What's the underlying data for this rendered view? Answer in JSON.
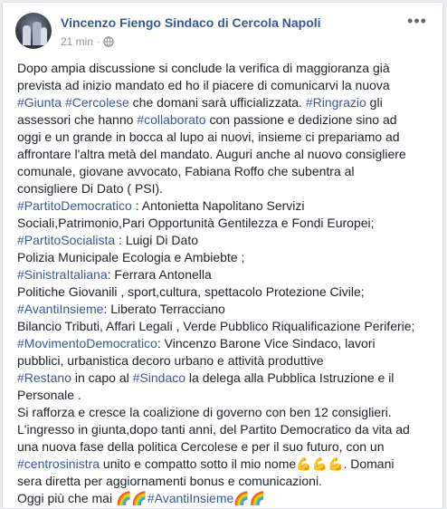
{
  "post": {
    "author": "Vincenzo Fiengo Sindaco di Cercola Napoli",
    "time": "21 min",
    "separator": "·",
    "privacy_icon": "globe-icon",
    "more_icon": "more-options-icon",
    "more_label": "•••",
    "lines": [
      [
        {
          "t": "Dopo ampia discussione si conclude la verifica di maggioranza già"
        }
      ],
      [
        {
          "t": "prevista ad inizio mandato ed ho il piacere di comunicarvi la nuova"
        }
      ],
      [
        {
          "h": "#Giunta"
        },
        {
          "t": " "
        },
        {
          "h": "#Cercolese"
        },
        {
          "t": " che domani sarà ufficializzata. "
        },
        {
          "h": "#Ringrazio"
        },
        {
          "t": " gli"
        }
      ],
      [
        {
          "t": "assessori che hanno "
        },
        {
          "h": "#collaborato"
        },
        {
          "t": " con passione e dedizione sino ad"
        }
      ],
      [
        {
          "t": "oggi e un grande in bocca al lupo ai nuovi, insieme ci prepariamo ad"
        }
      ],
      [
        {
          "t": "affrontare l'altra metà del mandato. Auguri anche al nuovo consigliere"
        }
      ],
      [
        {
          "t": "comunale, giovane avvocato, Fabiana Roffo che subentra al"
        }
      ],
      [
        {
          "t": "consigliere Di Dato ( PSI)."
        }
      ],
      [
        {
          "h": "#PartitoDemocratico"
        },
        {
          "t": " : Antonietta Napolitano Servizi"
        }
      ],
      [
        {
          "t": "Sociali,Patrimonio,Pari Opportunità Gentilezza e Fondi Europei;"
        }
      ],
      [
        {
          "h": "#PartitoSocialista"
        },
        {
          "t": " : Luigi Di Dato"
        }
      ],
      [
        {
          "t": "Polizia Municipale Ecologia e Ambiebte ;"
        }
      ],
      [
        {
          "h": "#SinistraItaliana"
        },
        {
          "t": ": Ferrara Antonella"
        }
      ],
      [
        {
          "t": "Politiche Giovanili  , sport,cultura, spettacolo Protezione Civile;"
        }
      ],
      [
        {
          "h": "#AvantiInsieme"
        },
        {
          "t": ": Liberato Terracciano"
        }
      ],
      [
        {
          "t": "Bilancio Tributi, Affari Legali , Verde Pubblico Riqualificazione Periferie;"
        }
      ],
      [
        {
          "h": "#MovimentoDemocratico"
        },
        {
          "t": ": Vincenzo Barone Vice Sindaco, lavori"
        }
      ],
      [
        {
          "t": "pubblici, urbanistica decoro urbano e attività produttive"
        }
      ],
      [
        {
          "h": "#Restano"
        },
        {
          "t": " in capo al "
        },
        {
          "h": "#Sindaco"
        },
        {
          "t": " la delega alla Pubblica Istruzione e il"
        }
      ],
      [
        {
          "t": "Personale ."
        }
      ],
      [
        {
          "t": "Si rafforza e cresce la coalizione di governo con ben 12 consiglieri."
        }
      ],
      [
        {
          "t": "L'ingresso in giunta,dopo tanti anni, del Partito Democratico da vita ad"
        }
      ],
      [
        {
          "t": "una nuova fase della politica Cercolese e per il suo futuro, con un"
        }
      ],
      [
        {
          "h": "#centrosinistra"
        },
        {
          "t": " unito e compatto sotto il mio nome"
        },
        {
          "e": "💪💪💪"
        },
        {
          "t": ". Domani"
        }
      ],
      [
        {
          "t": "sera diretta per aggiornamenti bonus e comunicazioni."
        }
      ],
      [
        {
          "t": "Oggi più che mai "
        },
        {
          "e": "🌈🌈"
        },
        {
          "h": "#AvantiInsieme"
        },
        {
          "e": "🌈🌈"
        }
      ]
    ]
  },
  "colors": {
    "link": "#365899",
    "text": "#1d2129",
    "meta": "#90949c",
    "background": "#e9ebee"
  }
}
